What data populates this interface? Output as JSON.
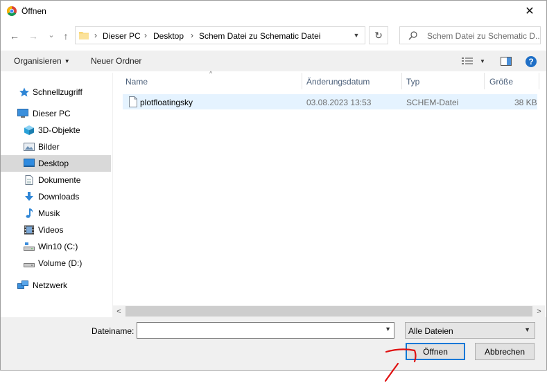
{
  "window": {
    "title": "Öffnen",
    "close_glyph": "✕"
  },
  "nav": {
    "back_glyph": "←",
    "forward_glyph": "→",
    "recent_glyph": "⌄",
    "up_glyph": "↑",
    "breadcrumb_sep": "›",
    "breadcrumbs": [
      "Dieser PC",
      "Desktop",
      "Schem Datei zu Schematic Datei"
    ],
    "refresh_glyph": "↻",
    "search_placeholder": "Schem Datei zu Schematic D..."
  },
  "toolbar": {
    "organize": "Organisieren",
    "new_folder": "Neuer Ordner",
    "help": "?"
  },
  "sidebar": {
    "items": [
      {
        "label": "Schnellzugriff",
        "icon": "star-icon"
      },
      {
        "label": "Dieser PC",
        "icon": "computer-icon"
      },
      {
        "label": "3D-Objekte",
        "icon": "cube-icon"
      },
      {
        "label": "Bilder",
        "icon": "pictures-icon"
      },
      {
        "label": "Desktop",
        "icon": "desktop-icon",
        "selected": true
      },
      {
        "label": "Dokumente",
        "icon": "document-icon"
      },
      {
        "label": "Downloads",
        "icon": "download-icon"
      },
      {
        "label": "Musik",
        "icon": "music-icon"
      },
      {
        "label": "Videos",
        "icon": "video-icon"
      },
      {
        "label": "Win10 (C:)",
        "icon": "drive-icon"
      },
      {
        "label": "Volume (D:)",
        "icon": "drive-icon"
      },
      {
        "label": "Netzwerk",
        "icon": "network-icon"
      }
    ]
  },
  "files": {
    "columns": [
      "Name",
      "Änderungsdatum",
      "Typ",
      "Größe"
    ],
    "sort_glyph": "^",
    "rows": [
      {
        "name": "plotfloatingsky",
        "date": "03.08.2023 13:53",
        "type": "SCHEM-Datei",
        "size": "38 KB"
      }
    ]
  },
  "scroll": {
    "left_glyph": "<",
    "right_glyph": ">"
  },
  "bottom": {
    "filename_label": "Dateiname:",
    "filename_value": "",
    "filter": "Alle Dateien",
    "open_button": "Öffnen",
    "cancel_button": "Abbrechen"
  },
  "colors": {
    "accent": "#0078d7",
    "selection": "#e5f3ff",
    "annotation": "#e01010"
  }
}
